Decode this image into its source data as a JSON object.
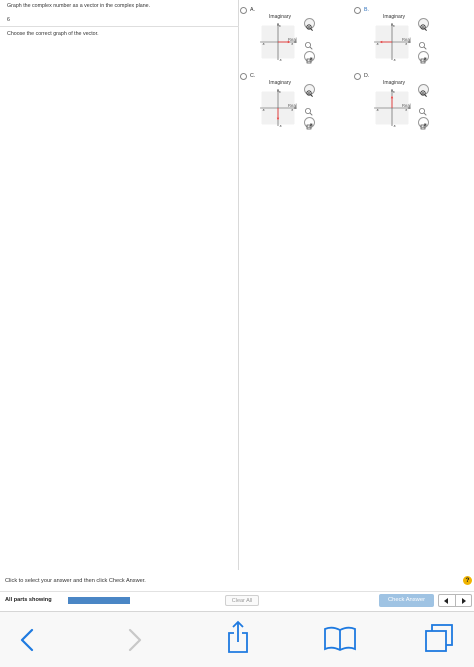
{
  "question": {
    "prompt": "Graph the complex number as a vector in the complex plane.",
    "number": "6",
    "instruction": "Choose the correct graph of the vector."
  },
  "options": [
    {
      "letter": "A.",
      "imag_label": "Imaginary",
      "real_label": "Real",
      "vector": [
        6,
        0
      ]
    },
    {
      "letter": "B.",
      "imag_label": "Imaginary",
      "real_label": "Real",
      "vector": [
        -6,
        0
      ]
    },
    {
      "letter": "C.",
      "imag_label": "Imaginary",
      "real_label": "Real",
      "vector": [
        0,
        -6
      ]
    },
    {
      "letter": "D.",
      "imag_label": "Imaginary",
      "real_label": "Real",
      "vector": [
        0,
        6
      ]
    }
  ],
  "axis": {
    "pos_y": "8",
    "neg_y": "-8",
    "neg_x": "-8",
    "pos_x": "8"
  },
  "footer": {
    "status": "Click to select your answer and then click Check Answer.",
    "parts_label": "All parts showing",
    "progress": 1.0,
    "clear_label": "Clear All",
    "check_label": "Check Answer",
    "help": "?"
  },
  "colors": {
    "vector": "#e03030",
    "option_b_letter": "#2a6ebb",
    "accent": "#1f7ae0"
  },
  "icons": {
    "zoom_in": "zoom-in-icon",
    "zoom_out": "zoom-out-icon",
    "popout": "external-link-icon",
    "back": "chevron-left-icon",
    "forward": "chevron-right-icon",
    "share": "share-icon",
    "bookmarks": "book-icon",
    "tabs": "tabs-icon"
  }
}
